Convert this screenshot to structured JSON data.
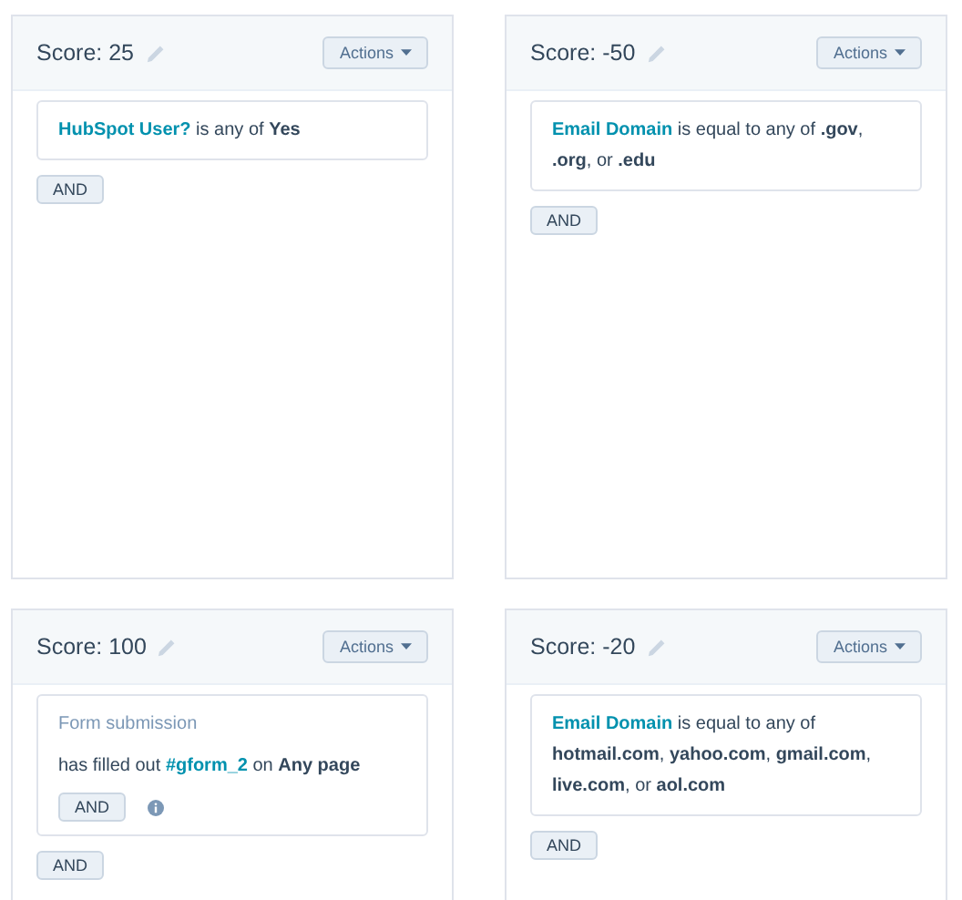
{
  "score_cards": [
    {
      "title": "Score: 25",
      "actions": "Actions",
      "criteria": [
        {
          "parts": [
            {
              "kind": "link",
              "text": "HubSpot User?"
            },
            {
              "kind": "text",
              "text": " is any of **Yes**"
            }
          ]
        }
      ],
      "and_button": "AND"
    },
    {
      "title": "Score: -50",
      "actions": "Actions",
      "criteria": [
        {
          "parts": [
            {
              "kind": "link",
              "text": "Email Domain"
            },
            {
              "kind": "text",
              "text": " is equal to any of **.gov**, **.org**, or **.edu**"
            }
          ]
        }
      ],
      "and_button": "AND"
    },
    {
      "title": "Score: 100",
      "actions": "Actions",
      "criteria": [
        {
          "heading": "Form submission",
          "parts": [
            {
              "kind": "text",
              "text": "has filled out "
            },
            {
              "kind": "link",
              "text": "#gform_2"
            },
            {
              "kind": "text",
              "text": " on **Any page**"
            }
          ],
          "and_button": "AND"
        }
      ],
      "and_button": "AND"
    },
    {
      "title": "Score: -20",
      "actions": "Actions",
      "criteria": [
        {
          "parts": [
            {
              "kind": "link",
              "text": "Email Domain"
            },
            {
              "kind": "text",
              "text": " is equal to any of **hotmail.com**, **yahoo.com**, **gmail.com**, **live.com**, or **aol.com**"
            }
          ]
        }
      ],
      "and_button": "AND"
    }
  ]
}
